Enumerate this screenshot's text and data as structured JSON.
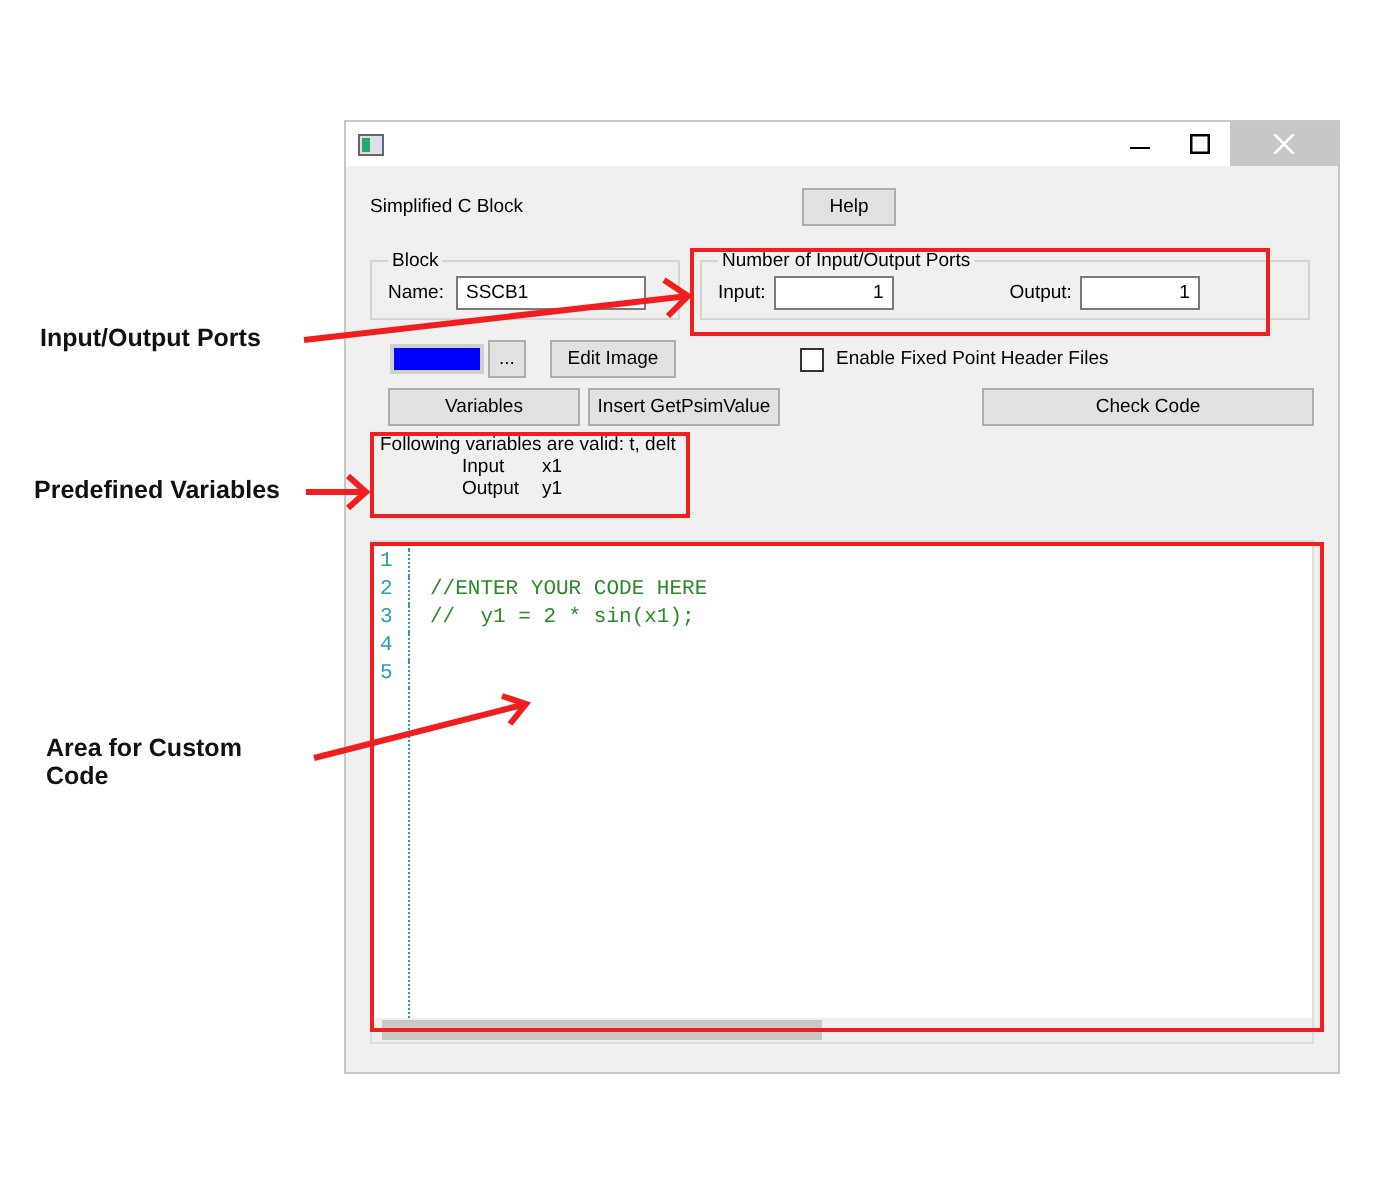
{
  "dialog": {
    "caption": "Simplified C Block",
    "help_button": "Help",
    "block": {
      "legend": "Block",
      "name_label": "Name:",
      "name_value": "SSCB1"
    },
    "ports": {
      "legend": "Number of Input/Output Ports",
      "input_label": "Input:",
      "input_value": "1",
      "output_label": "Output:",
      "output_value": "1"
    },
    "browse_button": "...",
    "edit_image_button": "Edit Image",
    "fixed_point": {
      "label": "Enable Fixed Point Header Files",
      "checked": false
    },
    "variables_button": "Variables",
    "insert_button": "Insert GetPsimValue",
    "check_button": "Check Code",
    "variables_info": {
      "heading": "Following variables are valid:  t, delt",
      "rows": [
        {
          "name": "Input",
          "value": "x1"
        },
        {
          "name": "Output",
          "value": "y1"
        }
      ]
    },
    "editor": {
      "lines": [
        {
          "number": "1"
        },
        {
          "number": "2",
          "code": "//ENTER YOUR CODE HERE"
        },
        {
          "number": "3",
          "code": "//  y1 = 2 * sin(x1);"
        },
        {
          "number": "4"
        },
        {
          "number": "5"
        }
      ]
    }
  },
  "annotations": [
    {
      "label": "Input/Output Ports"
    },
    {
      "label": "Predefined Variables"
    },
    {
      "label": "Area for Custom Code"
    }
  ]
}
